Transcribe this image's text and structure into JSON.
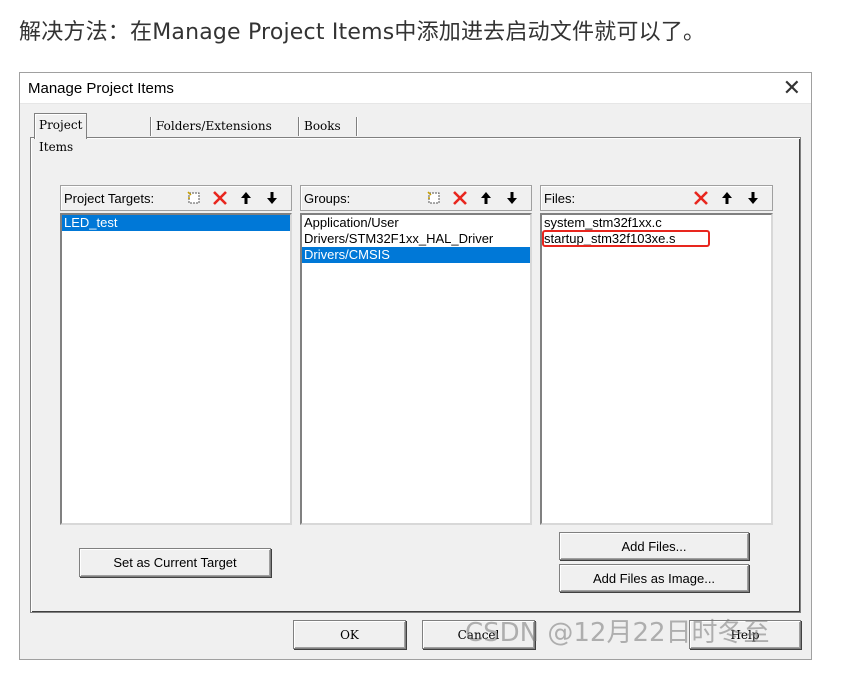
{
  "caption": "解决方法：在Manage Project Items中添加进去启动文件就可以了。",
  "dialog": {
    "title": "Manage Project Items",
    "close_label": "✕",
    "tabs": [
      "Project Items",
      "Folders/Extensions",
      "Books"
    ],
    "active_tab": "Project Items"
  },
  "targets": {
    "label": "Project Targets:",
    "items": [
      "LED_test"
    ],
    "selected": "LED_test"
  },
  "groups": {
    "label": "Groups:",
    "items": [
      "Application/User",
      "Drivers/STM32F1xx_HAL_Driver",
      "Drivers/CMSIS"
    ],
    "selected": "Drivers/CMSIS"
  },
  "files": {
    "label": "Files:",
    "items": [
      "system_stm32f1xx.c",
      "startup_stm32f103xe.s"
    ],
    "highlighted": "startup_stm32f103xe.s",
    "highlight_color": "#e8261e"
  },
  "buttons": {
    "set_current_target": "Set as Current Target",
    "add_files": "Add Files...",
    "add_files_as_image": "Add Files as Image...",
    "ok": "OK",
    "cancel": "Cancel",
    "help": "Help"
  },
  "icons": {
    "new": "new-item-icon",
    "delete": "delete-x-icon",
    "up": "arrow-up-icon",
    "down": "arrow-down-icon"
  },
  "colors": {
    "selection": "#0078d7",
    "delete_icon": "#e8261e"
  },
  "watermark": "CSDN @12月22日时冬至"
}
